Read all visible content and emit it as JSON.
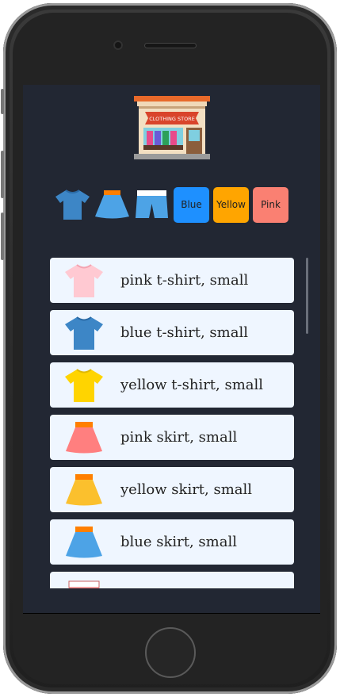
{
  "store": {
    "sign_text": "CLOTHING STORE"
  },
  "filters": {
    "categories": [
      "tshirt-icon",
      "skirt-icon",
      "shorts-icon"
    ],
    "colors": [
      {
        "label": "Blue",
        "color": "#1e90ff"
      },
      {
        "label": "Yellow",
        "color": "#ffa500"
      },
      {
        "label": "Pink",
        "color": "#fa8072"
      }
    ]
  },
  "items": [
    {
      "label": "pink t-shirt, small",
      "icon": "tshirt-icon",
      "color": "#ffc9d2"
    },
    {
      "label": "blue t-shirt, small",
      "icon": "tshirt-icon",
      "color": "#3d86c6"
    },
    {
      "label": "yellow t-shirt, small",
      "icon": "tshirt-icon",
      "color": "#ffd400"
    },
    {
      "label": "pink skirt, small",
      "icon": "skirt-icon",
      "color": "#ff7f7f"
    },
    {
      "label": "yellow skirt, small",
      "icon": "skirt-icon",
      "color": "#fbc02d"
    },
    {
      "label": "blue skirt, small",
      "icon": "skirt-icon",
      "color": "#4da3e6"
    },
    {
      "label": "",
      "icon": "shorts-icon",
      "color": "#ff7f7f"
    }
  ]
}
